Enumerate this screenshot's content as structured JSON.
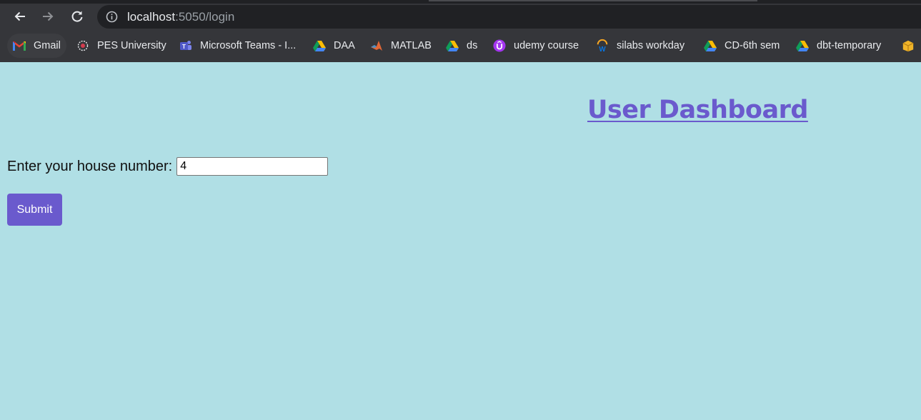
{
  "browser": {
    "url_host": "localhost",
    "url_rest": ":5050/login"
  },
  "bookmarks": [
    {
      "label": "Gmail",
      "icon": "gmail-icon"
    },
    {
      "label": "PES University",
      "icon": "pes-icon"
    },
    {
      "label": "Microsoft Teams - I...",
      "icon": "teams-icon"
    },
    {
      "label": "DAA",
      "icon": "drive-icon"
    },
    {
      "label": "MATLAB",
      "icon": "matlab-icon"
    },
    {
      "label": "ds",
      "icon": "drive-icon"
    },
    {
      "label": "udemy course",
      "icon": "udemy-icon"
    },
    {
      "label": "silabs workday",
      "icon": "workday-icon"
    },
    {
      "label": "CD-6th sem",
      "icon": "drive-icon"
    },
    {
      "label": "dbt-temporary",
      "icon": "drive-icon"
    },
    {
      "label": "",
      "icon": "folder-icon"
    }
  ],
  "page": {
    "title": "User Dashboard",
    "house_label": "Enter your house number:",
    "house_value": "4",
    "submit_label": "Submit"
  },
  "colors": {
    "background": "#b0dfe5",
    "accent": "#6a5acd"
  }
}
